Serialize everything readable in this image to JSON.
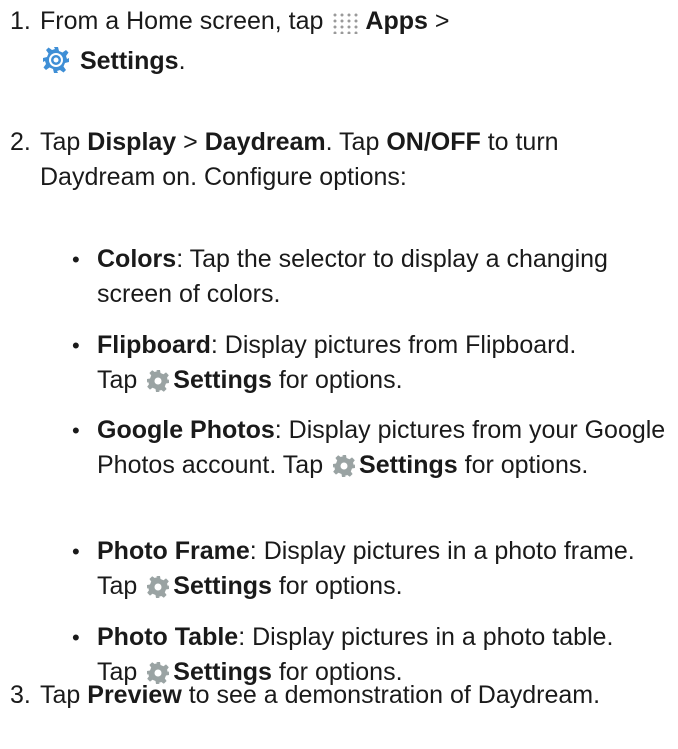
{
  "steps": [
    {
      "number": "1.",
      "t1": "From a Home screen, tap ",
      "apps": "Apps",
      "t2": " >",
      "settings": "Settings",
      "t3": "."
    },
    {
      "number": "2.",
      "t1": "Tap ",
      "display": "Display",
      "t2": " > ",
      "daydream": "Daydream",
      "t3": ". Tap ",
      "onoff": "ON/OFF",
      "t4": " to turn Daydream on. Configure options:",
      "options": [
        {
          "name": "Colors",
          "desc": ": Tap the selector to display a changing screen of colors."
        },
        {
          "name": "Flipboard",
          "desc": ": Display pictures from Flipboard.",
          "tap": "Tap ",
          "settings": "Settings",
          "tail": " for options."
        },
        {
          "name": "Google Photos",
          "desc": ": Display pictures from your Google Photos account.",
          "tap": " Tap ",
          "settings": "Settings",
          "tail": " for options."
        },
        {
          "name": "Photo Frame",
          "desc": ": Display pictures in a photo frame.",
          "tap": " Tap ",
          "settings": "Settings",
          "tail": " for options."
        },
        {
          "name": "Photo Table",
          "desc": ": Display pictures in a photo table.",
          "tap": "Tap ",
          "settings": "Settings",
          "tail": " for options."
        }
      ]
    },
    {
      "number": "3.",
      "t1": "Tap ",
      "preview": "Preview",
      "t2": " to see a demonstration of Daydream."
    }
  ],
  "icons": {
    "apps": "apps-grid-icon",
    "settings_app": "settings-app-icon",
    "settings_gear": "gear-icon"
  },
  "colors": {
    "settings_app_icon": "#3f8fd6",
    "gear_icon": "#9aa3a3"
  }
}
